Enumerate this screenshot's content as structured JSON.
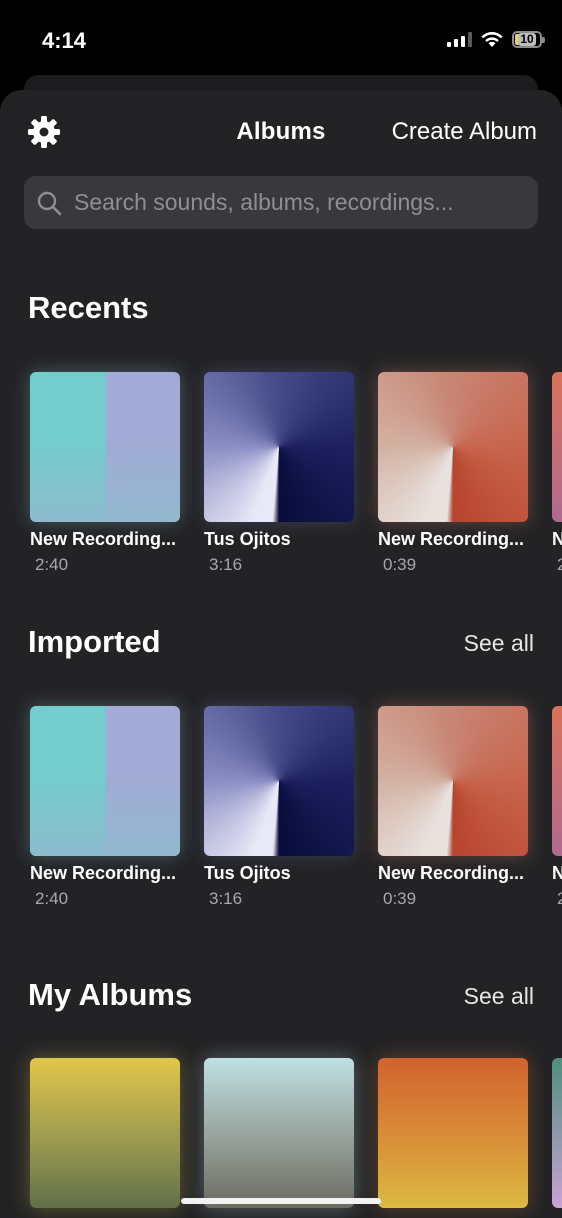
{
  "status_bar": {
    "time": "4:14",
    "battery": "10"
  },
  "nav": {
    "title": "Albums",
    "create_label": "Create Album"
  },
  "search": {
    "placeholder": "Search sounds, albums, recordings..."
  },
  "recents": {
    "title": "Recents",
    "items": [
      {
        "name": "New Recording...",
        "duration": "2:40"
      },
      {
        "name": "Tus Ojitos",
        "duration": "3:16"
      },
      {
        "name": "New Recording...",
        "duration": "0:39"
      },
      {
        "name": "N",
        "duration": "2"
      }
    ]
  },
  "imported": {
    "title": "Imported",
    "see_all": "See all",
    "items": [
      {
        "name": "New Recording...",
        "duration": "2:40"
      },
      {
        "name": "Tus Ojitos",
        "duration": "3:16"
      },
      {
        "name": "New Recording...",
        "duration": "0:39"
      },
      {
        "name": "N",
        "duration": "2"
      }
    ]
  },
  "my_albums": {
    "title": "My Albums",
    "see_all": "See all"
  }
}
